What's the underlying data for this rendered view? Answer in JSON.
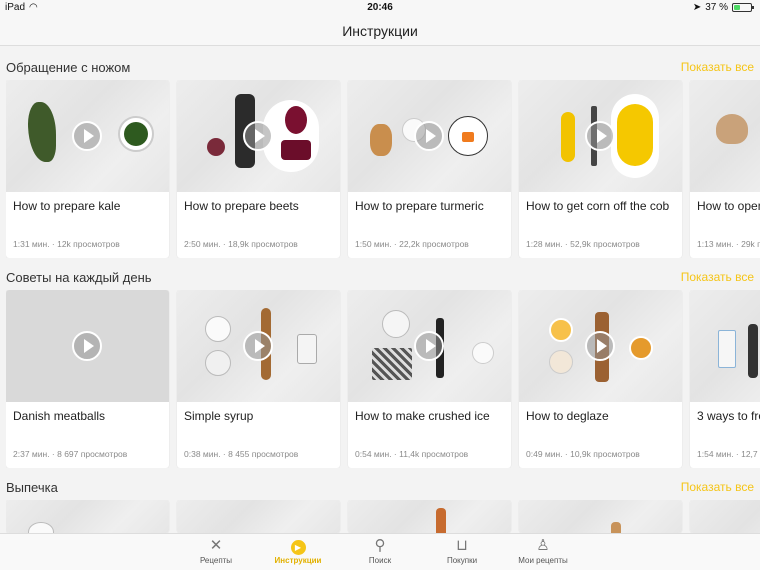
{
  "status": {
    "device": "iPad",
    "time": "20:46",
    "battery": "37 %",
    "battery_level": 0.37
  },
  "nav": {
    "title": "Инструкции"
  },
  "sections": [
    {
      "title": "Обращение с ножом",
      "show_all": "Показать все",
      "cards": [
        {
          "title": "How to prepare kale",
          "meta": "1:31 мин. · 12k просмотров"
        },
        {
          "title": "How to prepare beets",
          "meta": "2:50 мин. · 18,9k просмотров"
        },
        {
          "title": "How to prepare turmeric",
          "meta": "1:50 мин. · 22,2k просмотров"
        },
        {
          "title": "How to get corn off the cob",
          "meta": "1:28 мин. · 52,9k просмотров"
        },
        {
          "title": "How to open",
          "meta": "1:13 мин. · 29k п"
        }
      ]
    },
    {
      "title": "Советы на каждый день",
      "show_all": "Показать все",
      "cards": [
        {
          "title": "Danish meatballs",
          "meta": "2:37 мин. · 8 697 просмотров"
        },
        {
          "title": "Simple syrup",
          "meta": "0:38 мин. · 8 455 просмотров"
        },
        {
          "title": "How to make crushed ice",
          "meta": "0:54 мин. · 11,4k просмотров"
        },
        {
          "title": "How to deglaze",
          "meta": "0:49 мин. · 10,9k просмотров"
        },
        {
          "title": "3 ways to fro",
          "meta": "1:54 мин. · 12,7"
        }
      ]
    },
    {
      "title": "Выпечка",
      "show_all": "Показать все"
    }
  ],
  "tabs": [
    {
      "label": "Рецепты",
      "icon": "fork-knife-icon",
      "glyph": "✕"
    },
    {
      "label": "Инструкции",
      "icon": "play-circle-icon",
      "glyph": "▶"
    },
    {
      "label": "Поиск",
      "icon": "search-icon",
      "glyph": "⚲"
    },
    {
      "label": "Покупки",
      "icon": "basket-icon",
      "glyph": "⊔"
    },
    {
      "label": "Мои рецепты",
      "icon": "profile-icon",
      "glyph": "♙"
    }
  ],
  "colors": {
    "accent": "#f5c518",
    "background": "#f3f3f3",
    "card": "#ffffff"
  }
}
